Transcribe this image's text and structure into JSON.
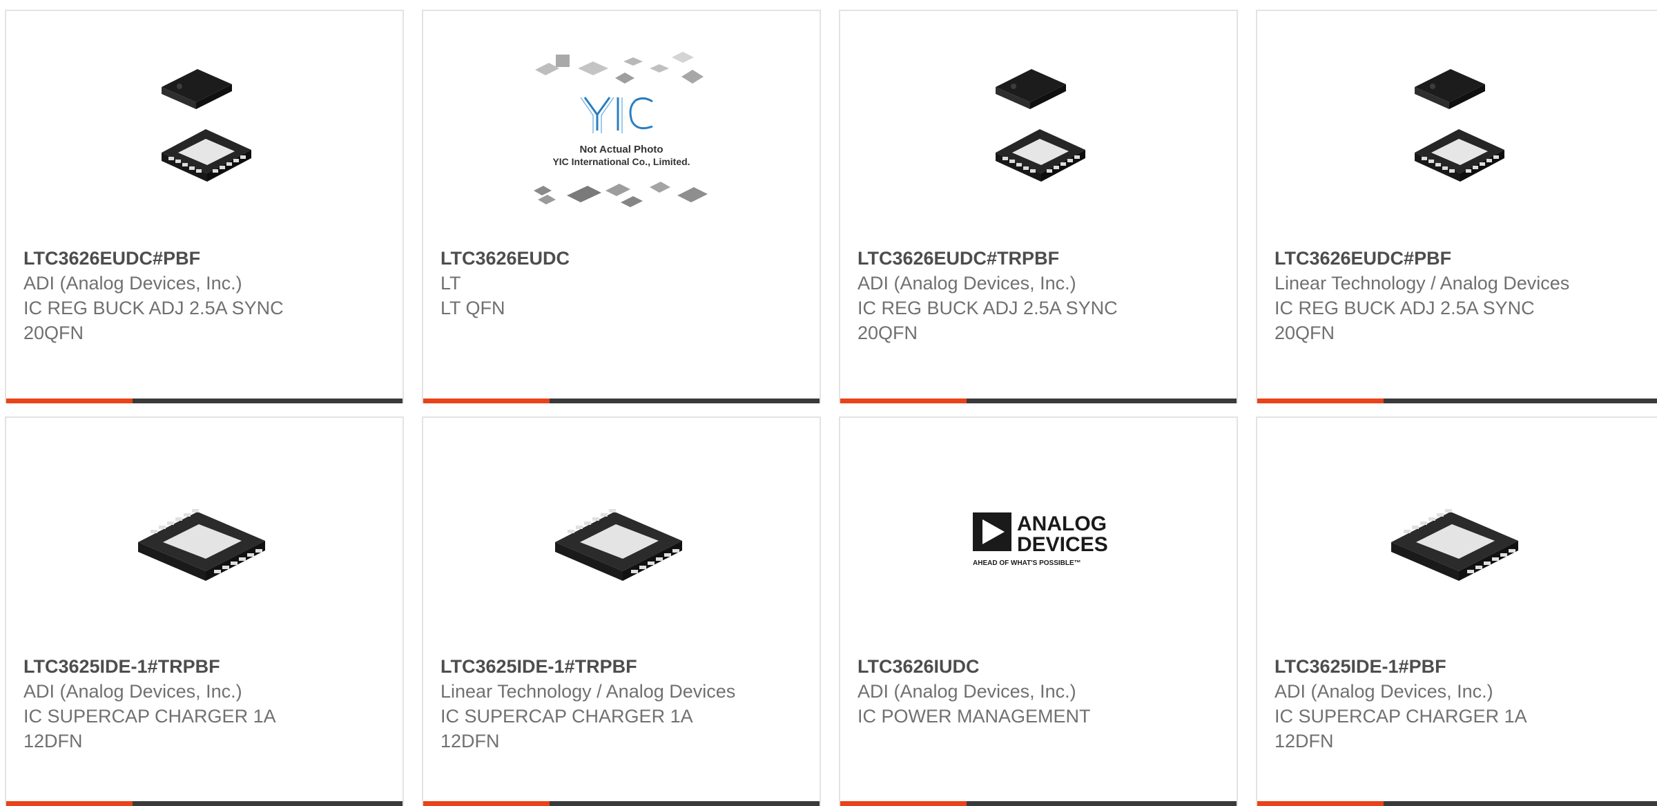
{
  "products": [
    {
      "part_number": "LTC3626EUDC#PBF",
      "manufacturer": "ADI (Analog Devices, Inc.)",
      "description": "IC REG BUCK ADJ 2.5A SYNC 20QFN",
      "image": "qfn20-chip-icon"
    },
    {
      "part_number": "LTC3626EUDC",
      "manufacturer": "LT",
      "description": "LT QFN",
      "image": "yic-placeholder-logo",
      "placeholder": {
        "brand": "YIC",
        "line1": "Not Actual Photo",
        "line2": "YIC International Co., Limited."
      }
    },
    {
      "part_number": "LTC3626EUDC#TRPBF",
      "manufacturer": "ADI (Analog Devices, Inc.)",
      "description": "IC REG BUCK ADJ 2.5A SYNC 20QFN",
      "image": "qfn20-chip-icon"
    },
    {
      "part_number": "LTC3626EUDC#PBF",
      "manufacturer": "Linear Technology / Analog Devices",
      "description": "IC REG BUCK ADJ 2.5A SYNC 20QFN",
      "image": "qfn20-chip-icon"
    },
    {
      "part_number": "LTC3625IDE-1#TRPBF",
      "manufacturer": "ADI (Analog Devices, Inc.)",
      "description": "IC SUPERCAP CHARGER 1A 12DFN",
      "image": "dfn12-chip-icon"
    },
    {
      "part_number": "LTC3625IDE-1#TRPBF",
      "manufacturer": "Linear Technology / Analog Devices",
      "description": "IC SUPERCAP CHARGER 1A 12DFN",
      "image": "dfn12-chip-icon"
    },
    {
      "part_number": "LTC3626IUDC",
      "manufacturer": "ADI (Analog Devices, Inc.)",
      "description": "IC POWER MANAGEMENT",
      "image": "analog-devices-logo",
      "logo": {
        "line1": "ANALOG",
        "line2": "DEVICES",
        "tagline": "AHEAD OF WHAT'S POSSIBLE™"
      }
    },
    {
      "part_number": "LTC3625IDE-1#PBF",
      "manufacturer": "ADI (Analog Devices, Inc.)",
      "description": "IC SUPERCAP CHARGER 1A 12DFN",
      "image": "dfn12-chip-icon"
    }
  ],
  "colors": {
    "accent": "#e8431a",
    "bar": "#3a3a3a",
    "border": "#e3e3e3"
  }
}
